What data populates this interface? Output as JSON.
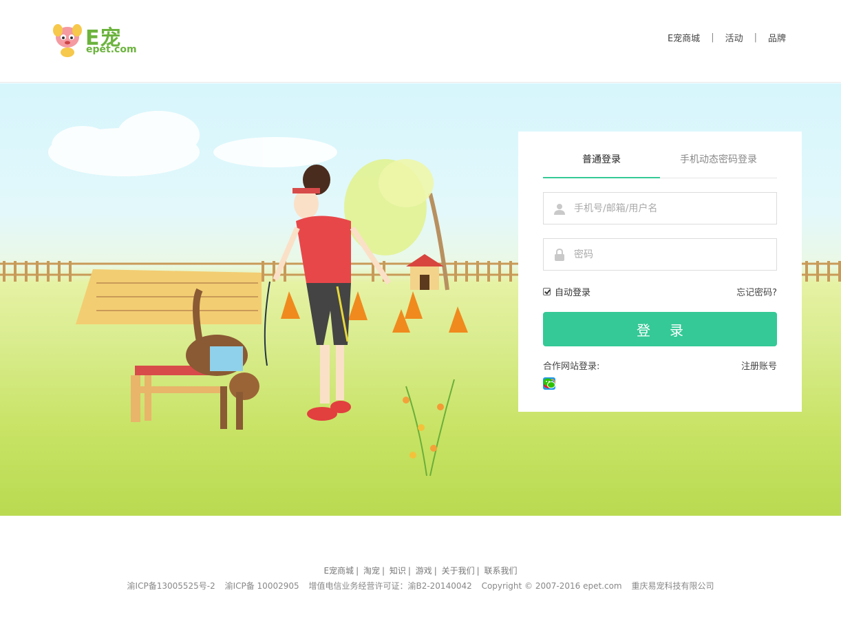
{
  "header": {
    "logo_text": "E宠",
    "logo_sub": "epet.com",
    "nav": [
      "E宠商城",
      "活动",
      "品牌"
    ],
    "nav_separator": "|"
  },
  "login": {
    "tabs": [
      "普通登录",
      "手机动态密码登录"
    ],
    "active_tab": 0,
    "username_placeholder": "手机号/邮箱/用户名",
    "password_placeholder": "密码",
    "auto_login_label": "自动登录",
    "auto_login_checked": true,
    "forgot_label": "忘记密码?",
    "submit_label": "登录",
    "partner_label": "合作网站登录:",
    "register_label": "注册账号",
    "social_icons": [
      "qq-icon",
      "alipay-icon",
      "weibo-icon",
      "wechat-icon"
    ]
  },
  "footer": {
    "links": [
      "E宠商城",
      "淘宠",
      "知识",
      "游戏",
      "关于我们",
      "联系我们"
    ],
    "info": [
      "渝ICP备13005525号-2",
      "渝ICP备 10002905",
      "增值电信业务经营许可证：渝B2-20140042",
      "Copyright © 2007-2016 epet.com",
      "重庆易宠科技有限公司"
    ]
  },
  "colors": {
    "accent": "#34c996",
    "logo_green": "#6cb33e",
    "sky": "#d6f6fc",
    "grass": "#c8e365"
  }
}
